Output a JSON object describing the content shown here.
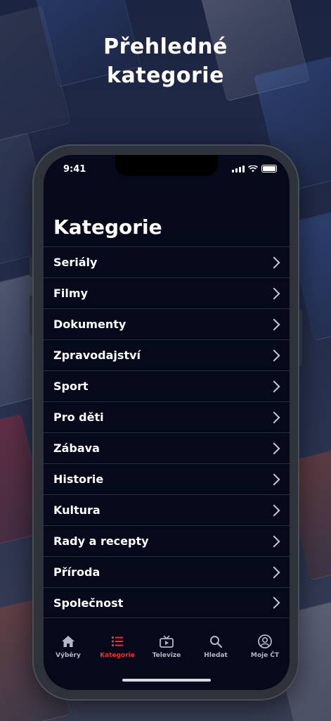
{
  "headline": {
    "line1": "Přehledné",
    "line2": "kategorie"
  },
  "status_bar": {
    "time": "9:41"
  },
  "page_title": "Kategorie",
  "categories": [
    {
      "label": "Seriály"
    },
    {
      "label": "Filmy"
    },
    {
      "label": "Dokumenty"
    },
    {
      "label": "Zpravodajství"
    },
    {
      "label": "Sport"
    },
    {
      "label": "Pro děti"
    },
    {
      "label": "Zábava"
    },
    {
      "label": "Historie"
    },
    {
      "label": "Kultura"
    },
    {
      "label": "Rady a recepty"
    },
    {
      "label": "Příroda"
    },
    {
      "label": "Společnost"
    }
  ],
  "tabbar": {
    "items": [
      {
        "label": "Výběry",
        "icon": "home-icon"
      },
      {
        "label": "Kategorie",
        "icon": "list-icon",
        "active": true
      },
      {
        "label": "Televize",
        "icon": "tv-icon"
      },
      {
        "label": "Hledat",
        "icon": "search-icon"
      },
      {
        "label": "Moje ČT",
        "icon": "profile-icon"
      }
    ]
  },
  "colors": {
    "accent": "#e8303b",
    "screen_bg": "#05091a",
    "background": "#1d2640"
  }
}
